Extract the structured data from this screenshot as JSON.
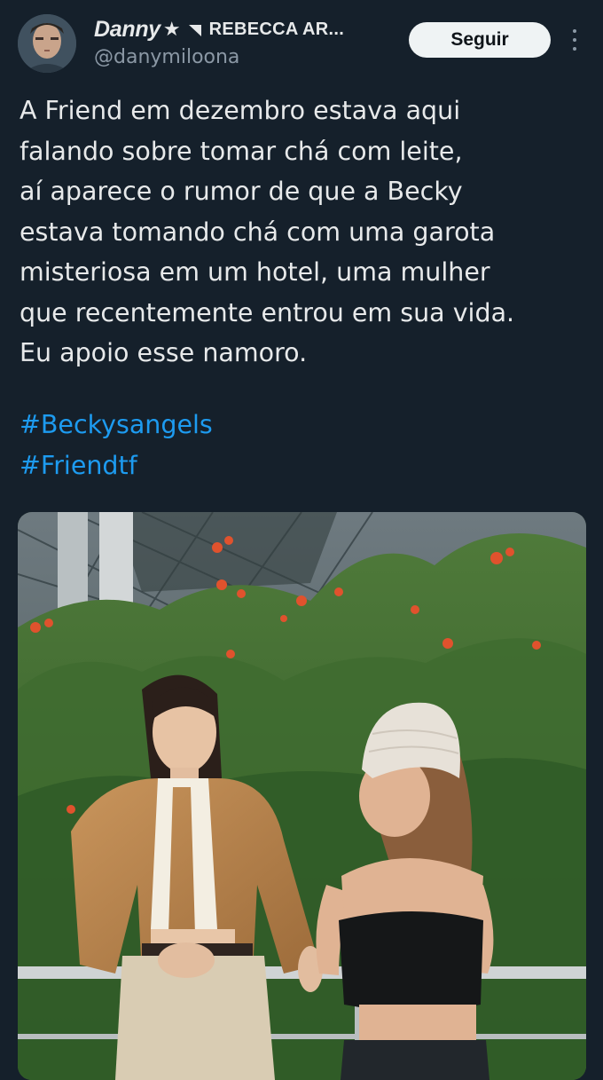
{
  "header": {
    "display_name": "Danny",
    "star_glyph": "★",
    "name_extra": "REBECCA AR...",
    "handle": "@danymiloona",
    "follow_label": "Seguir",
    "avatar_icon": "profile-photo",
    "flag_icon": "corner-flag-icon",
    "more_icon": "more-vertical-icon"
  },
  "tweet": {
    "lines": [
      "A Friend em dezembro estava aqui",
      "falando sobre tomar chá com leite,",
      "aí aparece o rumor de que a Becky",
      "estava tomando chá com uma garota",
      "misteriosa em um hotel, uma mulher",
      "que recentemente entrou em sua vida.",
      "Eu apoio esse namoro."
    ],
    "hashtags": [
      "#Beckysangels",
      "#Friendtf"
    ]
  },
  "colors": {
    "background": "#15202b",
    "text": "#e7e9ea",
    "muted": "#8b98a5",
    "link": "#1d9bf0",
    "button_bg": "#eff3f4"
  }
}
